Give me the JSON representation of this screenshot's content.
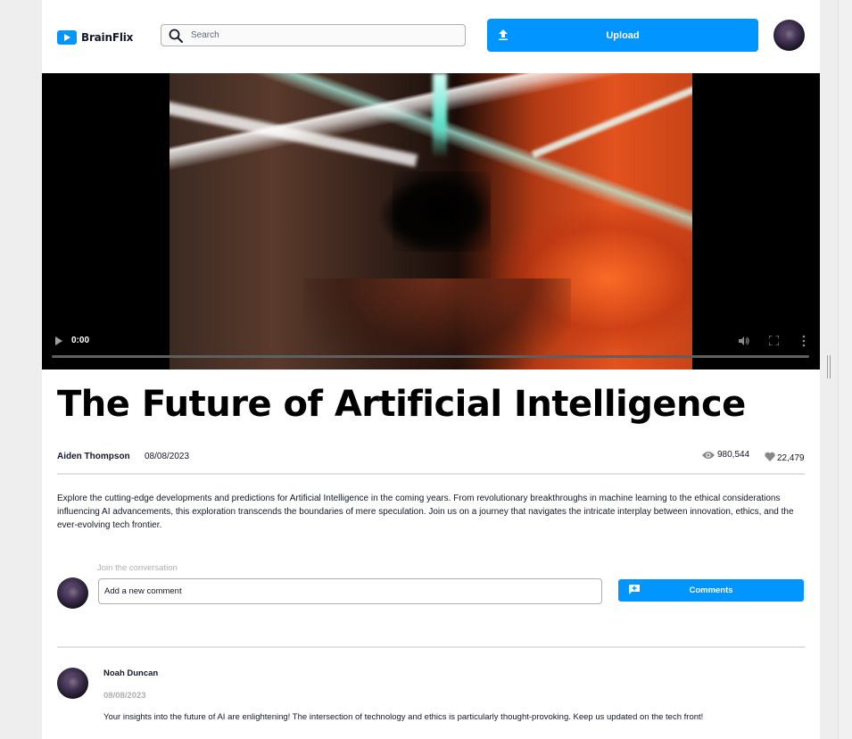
{
  "header": {
    "logo_text": "BrainFlix",
    "search_placeholder": "Search",
    "upload_label": "Upload"
  },
  "video": {
    "current_time": "0:00",
    "progress": 0
  },
  "details": {
    "title": "The Future of Artificial Intelligence",
    "author": "Aiden Thompson",
    "date": "08/08/2023",
    "views": "980,544",
    "likes": "22,479",
    "description": "Explore the cutting-edge developments and predictions for Artificial Intelligence in the coming years. From revolutionary breakthroughs in machine learning to the ethical considerations influencing AI advancements, this exploration transcends the boundaries of mere speculation. Join us on a journey that navigates the intricate interplay between innovation, ethics, and the ever-evolving tech frontier."
  },
  "comment_form": {
    "label": "Join the conversation",
    "placeholder": "Add a new comment",
    "button_label": "Comments"
  },
  "comments": [
    {
      "name": "Noah Duncan",
      "date": "08/08/2023",
      "text": "Your insights into the future of AI are enlightening! The intersection of technology and ethics is particularly thought-provoking. Keep us updated on the tech front!"
    }
  ],
  "colors": {
    "accent": "#0095ff",
    "text_dark": "#13182c",
    "muted": "#afafaf",
    "divider": "#e1e1e1"
  }
}
